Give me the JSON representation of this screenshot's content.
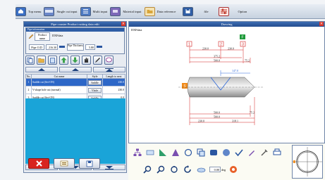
{
  "menu": {
    "items": [
      {
        "label": "Top menu",
        "icon": "home-icon",
        "color": "#3a6fc4"
      },
      {
        "label": "Single cut input",
        "icon": "pipe-icon",
        "color": "#6b87c9"
      },
      {
        "label": "Multi input",
        "icon": "list-icon",
        "color": "#4f7bc3"
      },
      {
        "label": "Material input",
        "icon": "material-icon",
        "color": "#7c68b8"
      },
      {
        "label": "Data reference",
        "icon": "folder-icon",
        "color": "#d8a53a"
      },
      {
        "label": "file",
        "icon": "save-icon",
        "color": "#2f5ea6"
      },
      {
        "label": "Option",
        "icon": "settings-icon",
        "color": "#c0392b"
      }
    ]
  },
  "left_panel": {
    "title": "Pipe coaster Product cutting data edit",
    "close": "×",
    "pipe_info": {
      "heading": "Pipe information",
      "product_label": "Product name",
      "product_value": "DXFdata",
      "od_label": "Pipe O.D",
      "od_value": "216.30",
      "thickness_label": "Pipe Thickness",
      "thickness_value": "5.80"
    },
    "table": {
      "headers": {
        "no": "No.",
        "name": "Cut name",
        "style": "Style",
        "length": "Length to next"
      },
      "rows": [
        {
          "no": "1",
          "name": "Saddle cut (Set-ON)",
          "style": "Saddle",
          "length": "230.0",
          "selected": true
        },
        {
          "no": "2",
          "name": "V-shape hole cut (normal)",
          "style": "Vhole",
          "length": "230.0",
          "selected": false
        },
        {
          "no": "3",
          "name": "Saddle cut (Set-ON)",
          "style": "Saddle",
          "length": "0.0",
          "selected": false
        }
      ]
    }
  },
  "drawing_panel": {
    "title": "Drawing",
    "close": "×",
    "file_name": "DXFdata",
    "markers": {
      "left": "1",
      "middle": "2",
      "right": "3",
      "f_badge": "F",
      "s_badge": "S"
    },
    "dims": {
      "top_a": "230.0",
      "top_b": "230.0",
      "row2_a": "375.2",
      "row2_b": "500.0",
      "row2_end": "75.2",
      "mid_label": "147.0",
      "bot_row1": "500.0",
      "bot_row1_end": "75.2",
      "bot_row2": "500.0",
      "bot_row3_a": "230.0",
      "bot_row3_b": "318.1"
    }
  },
  "bottom": {
    "angle_value": "0.00",
    "angle_unit": "deg"
  },
  "colors": {
    "title_bar": "#2f5ea6",
    "selected_row": "#2d67c7",
    "table_fill": "#1aa4d8",
    "delete": "#d8241f",
    "dim_red": "#d22020",
    "dim_blue": "#2b66d9"
  }
}
